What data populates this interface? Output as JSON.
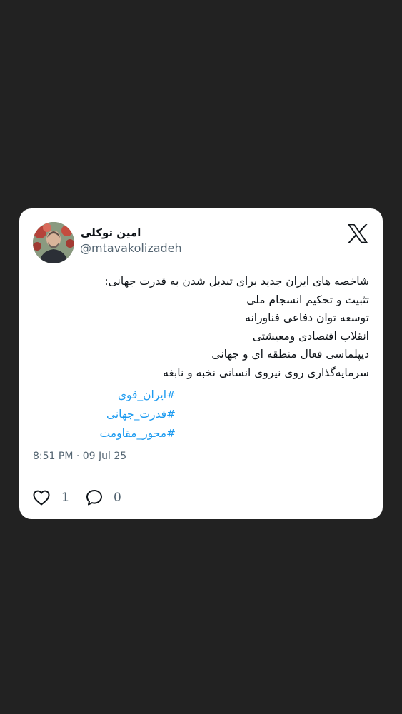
{
  "author": {
    "display_name": "امین توکلی",
    "handle": "@mtavakolizadeh"
  },
  "tweet": {
    "lines": [
      "شاخصه های ایران جدید برای تبدیل شدن به قدرت جهانی:",
      "تثبیت و تحکیم انسجام ملی",
      "توسعه توان دفاعی فناورانه",
      "انقلاب اقتصادی ومعیشتی",
      "دیپلماسی فعال منطقه ای و جهانی",
      "سرمایه‌گذاری روی نیروی انسانی نخبه و نابغه"
    ],
    "hashtags": [
      "#ایران_قوی",
      "#قدرت_جهانی",
      "#محور_مقاومت"
    ],
    "timestamp": "8:51 PM · 09 Jul 25"
  },
  "actions": {
    "like_count": "1",
    "reply_count": "0"
  },
  "icons": {
    "platform_logo": "x-logo-icon",
    "like": "heart-icon",
    "reply": "speech-bubble-icon"
  },
  "colors": {
    "background": "#222222",
    "card": "#ffffff",
    "hashtag": "#1d9bf0",
    "text": "#0f1419",
    "secondary": "#536471"
  }
}
